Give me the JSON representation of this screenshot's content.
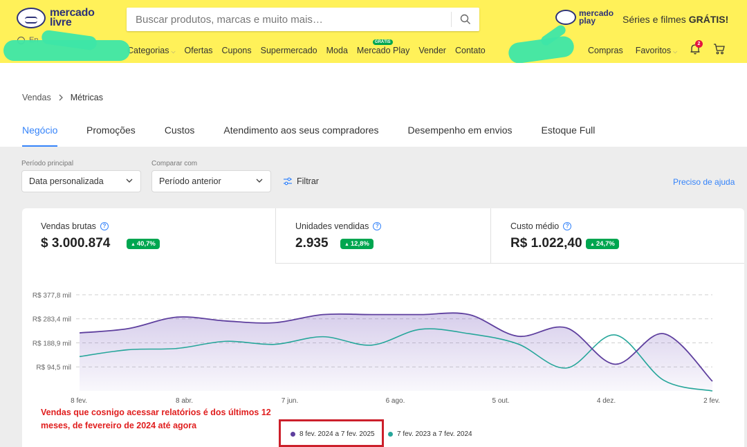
{
  "header": {
    "logo_line1": "mercado",
    "logo_line2": "livre",
    "search_placeholder": "Buscar produtos, marcas e muito mais…",
    "mplay_line1": "mercado",
    "mplay_line2": "play",
    "promo_text": "Séries e filmes ",
    "promo_bold": "GRÁTIS!",
    "location_prefix": "En",
    "nav": {
      "categorias": "Categorias",
      "ofertas": "Ofertas",
      "cupons": "Cupons",
      "supermercado": "Supermercado",
      "moda": "Moda",
      "mercado_play": "Mercado Play",
      "mercado_play_badge": "GRÁTIS",
      "vender": "Vender",
      "contato": "Contato"
    },
    "nav_right": {
      "compras": "Compras",
      "favoritos": "Favoritos"
    },
    "notifications_count": "2",
    "accent": "#fff159"
  },
  "breadcrumb": {
    "parent": "Vendas",
    "current": "Métricas"
  },
  "tabs": [
    "Negócio",
    "Promoções",
    "Custos",
    "Atendimento aos seus compradores",
    "Desempenho em envios",
    "Estoque Full"
  ],
  "filters": {
    "period_label": "Período principal",
    "period_value": "Data personalizada",
    "compare_label": "Comparar com",
    "compare_value": "Período anterior",
    "filter_button": "Filtrar",
    "help_link": "Preciso de ajuda"
  },
  "metrics": [
    {
      "label": "Vendas brutas",
      "value": "$ 3.000.874",
      "change": "40,7%"
    },
    {
      "label": "Unidades vendidas",
      "value": "2.935",
      "change": "12,8%"
    },
    {
      "label": "Custo médio",
      "value": "R$ 1.022,40",
      "change": "24,7%"
    }
  ],
  "annotation": "Vendas que cosnigo acessar relatórios é dos últimos 12 meses, de fevereiro de 2024 até agora",
  "chart_data": {
    "type": "area",
    "y_tick_labels": [
      "R$ 94,5 mil",
      "R$ 188,9 mil",
      "R$ 283,4 mil",
      "R$ 377,8 mil"
    ],
    "y_ticks": [
      94.5,
      188.9,
      283.4,
      377.8
    ],
    "ylim": [
      0,
      377.8
    ],
    "x_tick_labels": [
      "8 fev.",
      "8 abr.",
      "7 jun.",
      "6 ago.",
      "5 out.",
      "4 dez.",
      "2 fev."
    ],
    "x": [
      0,
      2,
      4,
      6,
      8,
      10,
      12,
      14,
      16,
      18,
      20,
      22,
      24,
      26
    ],
    "series": [
      {
        "name": "8 fev. 2024 a 7 fev. 2025",
        "color": "#5e3f9e",
        "values": [
          228,
          245,
          290,
          275,
          268,
          300,
          300,
          300,
          300,
          215,
          248,
          105,
          225,
          38
        ]
      },
      {
        "name": "7 fev. 2023 a 7 fev. 2024",
        "color": "#26a69a",
        "values": [
          135,
          162,
          167,
          195,
          183,
          213,
          180,
          242,
          225,
          185,
          90,
          220,
          42,
          0
        ]
      }
    ],
    "grid": true,
    "legend_position": "bottom"
  }
}
